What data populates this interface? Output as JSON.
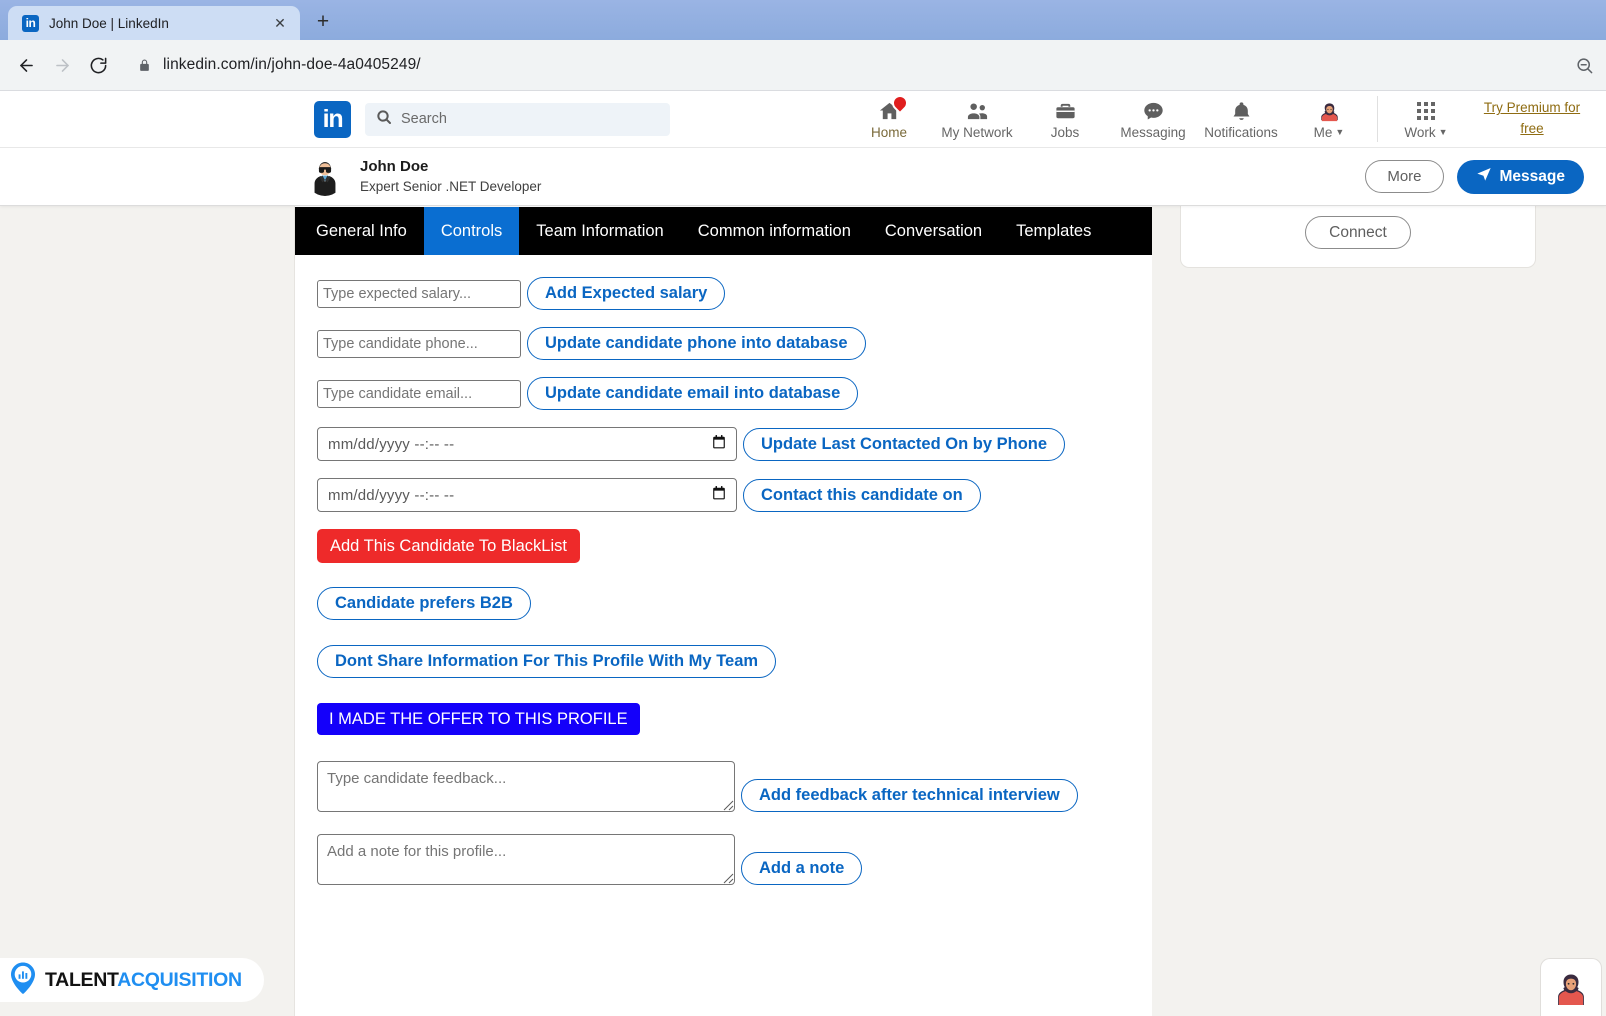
{
  "browser": {
    "tab_title": "John Doe | LinkedIn",
    "favicon_text": "in",
    "close_label": "✕",
    "newtab_label": "+",
    "back_icon": "back-arrow-icon",
    "forward_icon": "forward-arrow-icon",
    "reload_icon": "reload-icon",
    "lock_icon": "lock-icon",
    "url": "linkedin.com/in/john-doe-4a0405249/",
    "zoom_icon": "zoom-out-icon"
  },
  "linkedin_nav": {
    "logo_text": "in",
    "search_placeholder": "Search",
    "items": [
      {
        "label": "Home",
        "icon": "home-icon",
        "badge": true,
        "active": true
      },
      {
        "label": "My Network",
        "icon": "people-icon",
        "badge": false,
        "active": false
      },
      {
        "label": "Jobs",
        "icon": "briefcase-icon",
        "badge": false,
        "active": false
      },
      {
        "label": "Messaging",
        "icon": "chat-bubble-icon",
        "badge": false,
        "active": false
      },
      {
        "label": "Notifications",
        "icon": "bell-icon",
        "badge": false,
        "active": false
      },
      {
        "label": "Me",
        "icon": "avatar-icon",
        "badge": false,
        "active": false,
        "caret": "▼"
      }
    ],
    "work": {
      "label": "Work",
      "icon": "grid-icon",
      "caret": "▼"
    },
    "premium_link": "Try Premium for free"
  },
  "profile_header": {
    "avatar": "profile-avatar",
    "name": "John Doe",
    "headline": "Expert Senior .NET Developer",
    "more_label": "More",
    "message_label": "Message",
    "message_icon": "send-plane-icon"
  },
  "tabs": [
    {
      "label": "General Info",
      "active": false
    },
    {
      "label": "Controls",
      "active": true
    },
    {
      "label": "Team Information",
      "active": false
    },
    {
      "label": "Common information",
      "active": false
    },
    {
      "label": "Conversation",
      "active": false
    },
    {
      "label": "Templates",
      "active": false
    }
  ],
  "controls": {
    "salary": {
      "placeholder": "Type expected salary...",
      "value": "",
      "button": "Add Expected salary"
    },
    "phone": {
      "placeholder": "Type candidate phone...",
      "value": "",
      "button": "Update candidate phone into database"
    },
    "email": {
      "placeholder": "Type candidate email...",
      "value": "",
      "button": "Update candidate email into database"
    },
    "last_contacted": {
      "placeholder": "mm/dd/yyyy --:-- --",
      "value": "",
      "button": "Update Last Contacted On by Phone",
      "icon": "calendar-icon"
    },
    "contact_on": {
      "placeholder": "mm/dd/yyyy --:-- --",
      "value": "",
      "button": "Contact this candidate on",
      "icon": "calendar-icon"
    },
    "blacklist_button": "Add This Candidate To BlackList",
    "b2b_button": "Candidate prefers B2B",
    "dont_share_button": "Dont Share Information For This Profile With My Team",
    "offer_button": "I MADE THE OFFER TO THIS PROFILE",
    "feedback": {
      "placeholder": "Type candidate feedback...",
      "value": "",
      "button": "Add feedback after technical interview"
    },
    "note": {
      "placeholder": "Add a note for this profile...",
      "value": "",
      "button": "Add a note"
    }
  },
  "sidebar": {
    "connect_label": "Connect"
  },
  "watermark": {
    "text_dark": "TALENT",
    "text_blue": "ACQUISITION",
    "icon": "map-pin-chart-icon"
  },
  "chat_widget": {
    "avatar": "chat-avatar-icon"
  },
  "colors": {
    "linkedin_blue": "#0a66c2",
    "tab_active_blue": "#0a6ed1",
    "danger_red": "#ee2a2a",
    "offer_blue": "#1400fa",
    "page_bg": "#f3f2ef",
    "premium_gold": "#8f6c12",
    "brand_blue": "#1f8ef1"
  }
}
